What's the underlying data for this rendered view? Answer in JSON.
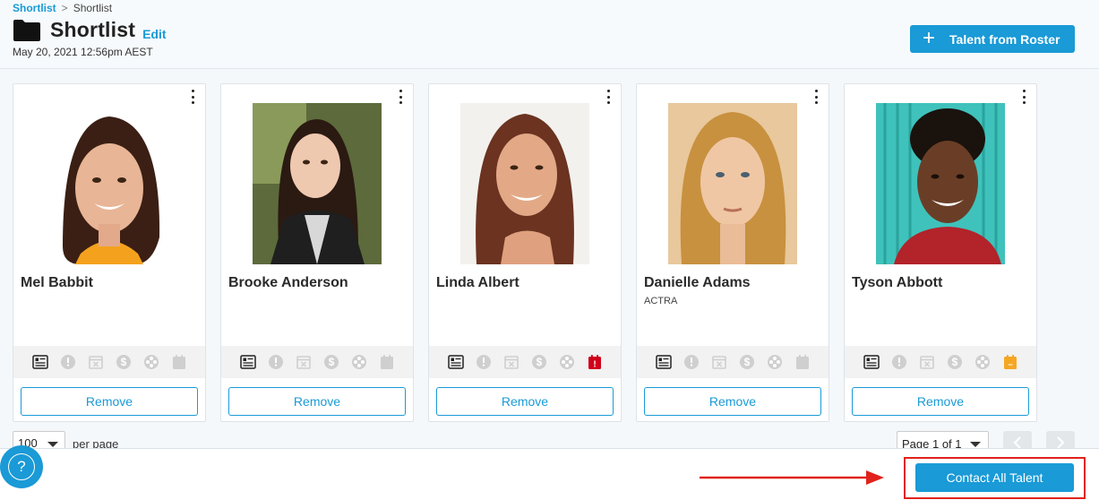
{
  "breadcrumb": {
    "root": "Shortlist",
    "separator": ">",
    "current": "Shortlist"
  },
  "header": {
    "title": "Shortlist",
    "edit_label": "Edit",
    "timestamp": "May 20, 2021 12:56pm AEST",
    "roster_button": {
      "icon": "+",
      "label": "Talent from Roster"
    }
  },
  "cards": [
    {
      "name": "Mel Babbit",
      "union": "",
      "remove_label": "Remove",
      "last_status_color": "#cfcfcf",
      "last_status_glyph": ""
    },
    {
      "name": "Brooke Anderson",
      "union": "",
      "remove_label": "Remove",
      "last_status_color": "#cfcfcf",
      "last_status_glyph": ""
    },
    {
      "name": "Linda Albert",
      "union": "",
      "remove_label": "Remove",
      "last_status_color": "#d0021b",
      "last_status_glyph": "!"
    },
    {
      "name": "Danielle Adams",
      "union": "ACTRA",
      "remove_label": "Remove",
      "last_status_color": "#cfcfcf",
      "last_status_glyph": ""
    },
    {
      "name": "Tyson Abbott",
      "union": "",
      "remove_label": "Remove",
      "last_status_color": "#f5a623",
      "last_status_glyph": "–"
    }
  ],
  "status_icons": [
    "resume-icon",
    "alert-icon",
    "calendar-x-icon",
    "dollar-icon",
    "film-reel-icon",
    "calendar-status-icon"
  ],
  "pagination": {
    "per_page_value": "100",
    "per_page_label": "per page",
    "page_label": "Page 1 of 1"
  },
  "footer": {
    "help_glyph": "?",
    "contact_label": "Contact All Talent"
  },
  "colors": {
    "accent": "#1a9ad6",
    "highlight": "#e0231c"
  }
}
